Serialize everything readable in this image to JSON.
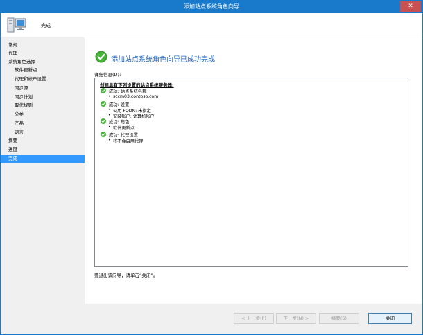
{
  "window": {
    "title": "添加站点系统角色向导",
    "close_glyph": "✕"
  },
  "header": {
    "title": "完成",
    "icon": "computer-icon"
  },
  "sidebar": {
    "items": [
      {
        "label": "常规",
        "indent": 0,
        "active": false
      },
      {
        "label": "代理",
        "indent": 0,
        "active": false
      },
      {
        "label": "系统角色选择",
        "indent": 0,
        "active": false
      },
      {
        "label": "软件更新点",
        "indent": 1,
        "active": false
      },
      {
        "label": "代理和帐户设置",
        "indent": 1,
        "active": false
      },
      {
        "label": "同步源",
        "indent": 1,
        "active": false
      },
      {
        "label": "同步计划",
        "indent": 1,
        "active": false
      },
      {
        "label": "取代规则",
        "indent": 1,
        "active": false
      },
      {
        "label": "分类",
        "indent": 1,
        "active": false
      },
      {
        "label": "产品",
        "indent": 1,
        "active": false
      },
      {
        "label": "语言",
        "indent": 1,
        "active": false
      },
      {
        "label": "摘要",
        "indent": 0,
        "active": false
      },
      {
        "label": "进度",
        "indent": 0,
        "active": false
      },
      {
        "label": "完成",
        "indent": 0,
        "active": true
      }
    ]
  },
  "main": {
    "success_title": "添加站点系统角色向导已成功完成",
    "details_label": "详细信息(D):",
    "details": {
      "heading": "创建具有下列设置的站点系统服务器:",
      "sections": [
        {
          "status": "成功: 站点系统名称",
          "items": [
            "sccm03.contoso.com"
          ]
        },
        {
          "status": "成功: 设置",
          "items": [
            "公用 FQDN: 未指定",
            "安装帐户: 计算机帐户"
          ]
        },
        {
          "status": "成功: 角色",
          "items": [
            "软件更新点"
          ]
        },
        {
          "status": "成功: 代理设置",
          "items": [
            "将不会启用代理"
          ]
        }
      ]
    },
    "exit_text": "要退出该向导，请单击“关闭”。"
  },
  "footer": {
    "prev_label": "< 上一步(P)",
    "next_label": "下一步(N) >",
    "summary_label": "摘要(S)",
    "close_label": "关闭"
  },
  "colors": {
    "titlebar": "#1979ca",
    "accent": "#3399ff",
    "success": "#3a9a2c",
    "title_text": "#2266bb"
  }
}
